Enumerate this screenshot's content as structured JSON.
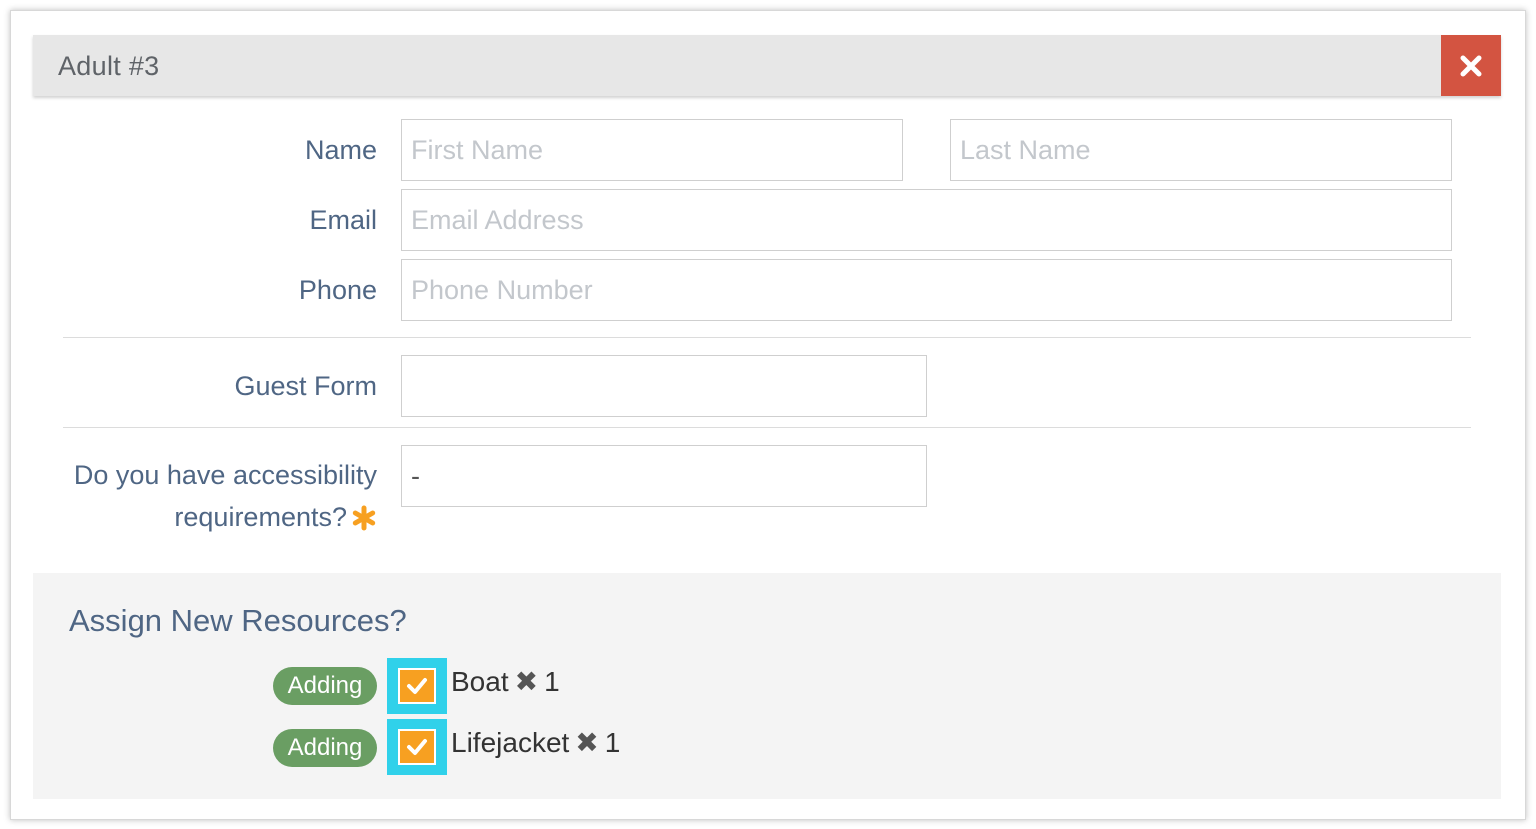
{
  "header": {
    "title": "Adult #3"
  },
  "fields": {
    "name_label": "Name",
    "first_name_placeholder": "First Name",
    "last_name_placeholder": "Last Name",
    "email_label": "Email",
    "email_placeholder": "Email Address",
    "phone_label": "Phone",
    "phone_placeholder": "Phone Number",
    "guest_form_label": "Guest Form",
    "guest_form_value": "",
    "accessibility_label_line1": "Do you have accessibility",
    "accessibility_label_line2": "requirements?",
    "accessibility_value": "-"
  },
  "resources": {
    "title": "Assign New Resources?",
    "items": [
      {
        "badge": "Adding",
        "name": "Boat",
        "multiplier": "✖",
        "quantity": "1",
        "checked": true
      },
      {
        "badge": "Adding",
        "name": "Lifejacket",
        "multiplier": "✖",
        "quantity": "1",
        "checked": true
      }
    ]
  },
  "colors": {
    "close_button": "#d35441",
    "badge": "#6a9e63",
    "checkbox": "#f7a021",
    "checkbox_highlight": "#30d1ea",
    "required_asterisk": "#f7a021",
    "label_text": "#4f6684"
  },
  "icons": {
    "close": "close-icon",
    "check": "check-icon",
    "required": "asterisk-icon"
  }
}
